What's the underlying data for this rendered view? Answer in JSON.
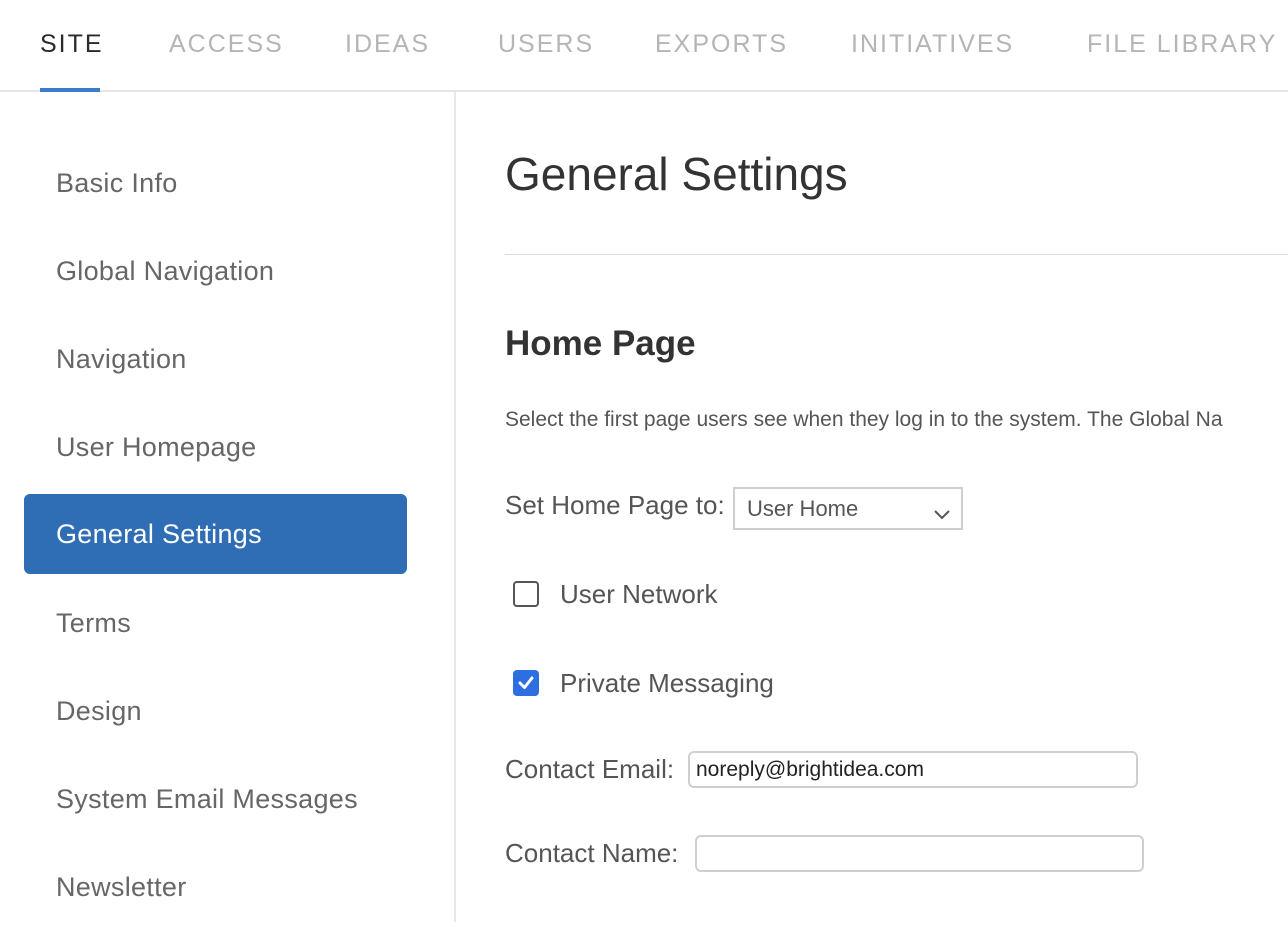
{
  "tabs": [
    {
      "label": "SITE",
      "active": true
    },
    {
      "label": "ACCESS",
      "active": false
    },
    {
      "label": "IDEAS",
      "active": false
    },
    {
      "label": "USERS",
      "active": false
    },
    {
      "label": "EXPORTS",
      "active": false
    },
    {
      "label": "INITIATIVES",
      "active": false
    },
    {
      "label": "FILE LIBRARY",
      "active": false
    }
  ],
  "sidebar": {
    "items": [
      {
        "label": "Basic Info"
      },
      {
        "label": "Global Navigation"
      },
      {
        "label": "Navigation"
      },
      {
        "label": "User Homepage"
      },
      {
        "label": "General Settings",
        "active": true
      },
      {
        "label": "Terms"
      },
      {
        "label": "Design"
      },
      {
        "label": "System Email Messages"
      },
      {
        "label": "Newsletter"
      }
    ]
  },
  "main": {
    "title": "General Settings",
    "section_title": "Home Page",
    "description": "Select the first page users see when they log in to the system. The Global Na",
    "home_page": {
      "label": "Set Home Page to:",
      "value": "User Home"
    },
    "user_network": {
      "label": "User Network",
      "checked": false
    },
    "private_messaging": {
      "label": "Private Messaging",
      "checked": true
    },
    "contact_email": {
      "label": "Contact Email:",
      "value": "noreply@brightidea.com"
    },
    "contact_name": {
      "label": "Contact Name:",
      "value": ""
    }
  },
  "colors": {
    "accent": "#2f6db5",
    "checkbox_checked": "#2d6fe0",
    "tab_underline": "#3d7cc9"
  },
  "icons": {
    "select_chevron": "chevron-down-icon",
    "checkmark": "check-icon"
  }
}
